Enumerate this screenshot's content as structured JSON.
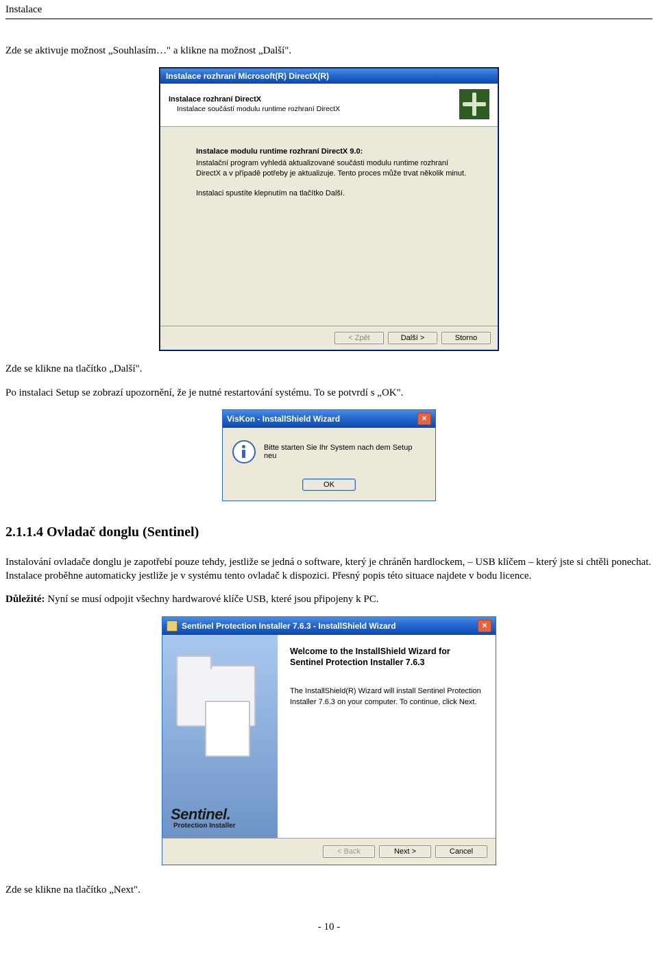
{
  "header": "Instalace",
  "text": {
    "p1": "Zde se aktivuje možnost „Souhlasím…\" a klikne na možnost „Další\".",
    "p2": "Zde se klikne na tlačítko „Další\".",
    "p3": "Po instalaci Setup se zobrazí upozornění, že je nutné restartování systému. To se potvrdí s „OK\".",
    "sec_heading": "2.1.1.4 Ovladač donglu (Sentinel)",
    "p4": "Instalování ovladače donglu je zapotřebí pouze tehdy, jestliže se jedná o software, který je chráněn hardlockem, – USB klíčem – který jste si chtěli ponechat. Instalace proběhne automaticky jestliže je v systému tento ovladač k dispozici. Přesný popis této situace najdete v bodu licence.",
    "p5_bold": "Důležité:",
    "p5_rest": " Nyní se musí odpojit všechny hardwarové klíče USB, které jsou připojeny k PC.",
    "p6": "Zde se klikne na tlačítko „Next\".",
    "page_num": "- 10 -"
  },
  "directx": {
    "title": "Instalace rozhraní Microsoft(R) DirectX(R)",
    "h1": "Instalace rozhraní DirectX",
    "h2": "Instalace součástí modulu runtime rozhraní DirectX",
    "b_title": "Instalace modulu runtime rozhraní DirectX 9.0:",
    "b_text1": "Instalační program vyhledá aktualizované součásti modulu runtime rozhraní DirectX a v případě potřeby je aktualizuje. Tento proces může trvat několik minut.",
    "b_text2": "Instalaci spustíte klepnutím na tlačítko Další.",
    "btn_back": "< Zpět",
    "btn_next": "Další >",
    "btn_cancel": "Storno"
  },
  "viskon": {
    "title": "VisKon      - InstallShield Wizard",
    "msg": "Bitte starten Sie Ihr System nach dem Setup neu",
    "ok": "OK"
  },
  "sentinel": {
    "title": "Sentinel Protection Installer 7.6.3 - InstallShield Wizard",
    "welcome_title": "Welcome to the InstallShield Wizard for Sentinel Protection Installer 7.6.3",
    "welcome_body": "The InstallShield(R) Wizard will install Sentinel Protection Installer 7.6.3 on your computer. To continue, click Next.",
    "logo1": "Sentinel.",
    "logo2": "Protection Installer",
    "btn_back": "< Back",
    "btn_next": "Next >",
    "btn_cancel": "Cancel"
  }
}
